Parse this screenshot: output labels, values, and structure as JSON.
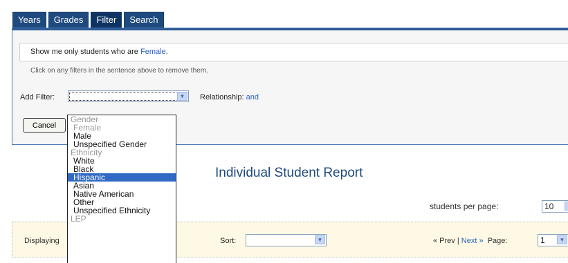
{
  "tabs": [
    "Years",
    "Grades",
    "Filter",
    "Search"
  ],
  "filter_panel": {
    "sentence_prefix": "Show me only students who are ",
    "sentence_value": "Female",
    "sentence_suffix": ".",
    "hint": "Click on any filters in the sentence above to remove them.",
    "add_filter_label": "Add Filter:",
    "add_filter_value": "",
    "relationship_label": "Relationship:",
    "relationship_value": "and",
    "cancel_button": "Cancel"
  },
  "dropdown": {
    "items": [
      {
        "type": "group",
        "label": "Gender"
      },
      {
        "type": "option",
        "label": "Female",
        "state": "disabled"
      },
      {
        "type": "option",
        "label": "Male",
        "state": "normal"
      },
      {
        "type": "option",
        "label": "Unspecified Gender",
        "state": "normal"
      },
      {
        "type": "group",
        "label": "Ethnicity"
      },
      {
        "type": "option",
        "label": "White",
        "state": "normal"
      },
      {
        "type": "option",
        "label": "Black",
        "state": "normal"
      },
      {
        "type": "option",
        "label": "Hispanic",
        "state": "selected"
      },
      {
        "type": "option",
        "label": "Asian",
        "state": "normal"
      },
      {
        "type": "option",
        "label": "Native American",
        "state": "normal"
      },
      {
        "type": "option",
        "label": "Other",
        "state": "normal"
      },
      {
        "type": "option",
        "label": "Unspecified Ethnicity",
        "state": "normal"
      },
      {
        "type": "group",
        "label": "LEP"
      }
    ]
  },
  "report": {
    "title": "Individual Student Report",
    "per_page_label": "students per page:",
    "per_page_value": "10"
  },
  "toolbar": {
    "displaying_label": "Displaying",
    "sort_label": "Sort:",
    "sort_value": "",
    "prev_label": "« Prev",
    "separator": " | ",
    "next_label": "Next »",
    "page_label": "Page:",
    "page_value": "1"
  },
  "colors": {
    "tab_bg": "#1e4a80",
    "link": "#2a5fc4",
    "selected_option": "#316ac5",
    "toolbar_bg": "#fdf9e4"
  }
}
